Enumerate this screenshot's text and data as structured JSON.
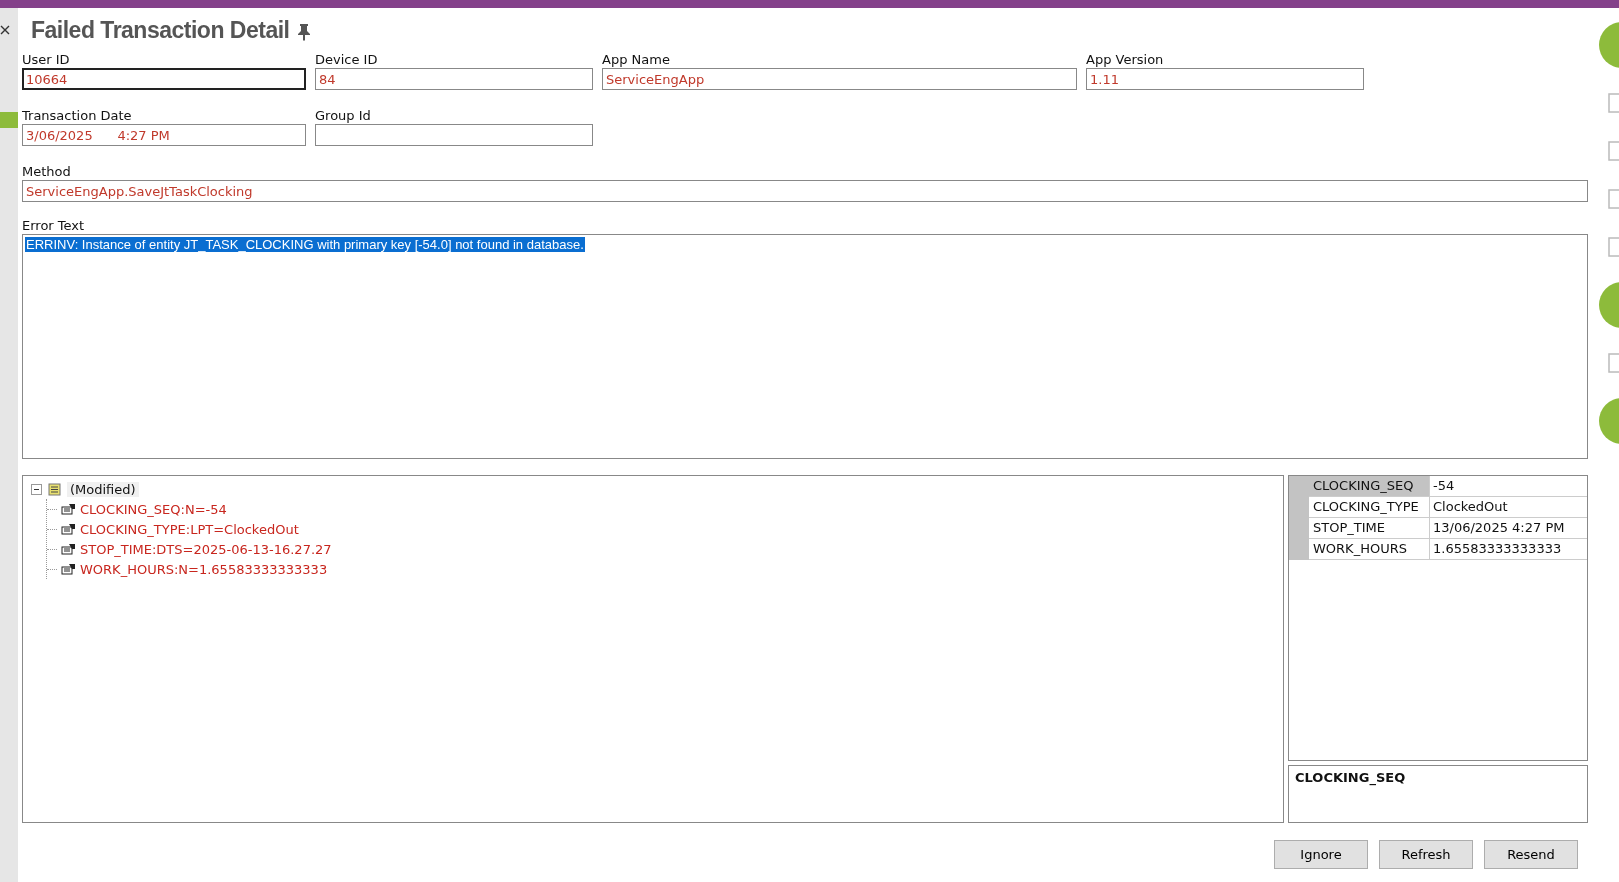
{
  "title": "Failed Transaction Detail",
  "fields": [
    {
      "label": "User ID",
      "value": "10664",
      "focused": true
    },
    {
      "label": "Device ID",
      "value": "84",
      "focused": false
    },
    {
      "label": "App Name",
      "value": "ServiceEngApp",
      "focused": false
    },
    {
      "label": "App Version",
      "value": "1.11",
      "focused": false
    },
    {
      "label": "Transaction Date",
      "value": "3/06/2025      4:27 PM",
      "focused": false
    },
    {
      "label": "Group Id",
      "focused": false
    }
  ],
  "method": {
    "label": "Method",
    "value": "ServiceEngApp.SaveJtTaskClocking"
  },
  "error_text": {
    "label": "Error Text",
    "value": "ERRINV: Instance of entity JT_TASK_CLOCKING with primary key [-54.0] not found in database.",
    "selected": true
  },
  "tree": {
    "label": "(Modified)",
    "expanded": true,
    "children": [
      {
        "label": "CLOCKING_SEQ:N=-54"
      },
      {
        "label": "CLOCKING_TYPE:LPT=ClockedOut"
      },
      {
        "label": "STOP_TIME:DTS=2025-06-13-16.27.27"
      },
      {
        "label": "WORK_HOURS:N=1.65583333333333"
      }
    ]
  },
  "properties": [
    {
      "name": "CLOCKING_SEQ",
      "value": "-54",
      "selected": true
    },
    {
      "name": "CLOCKING_TYPE",
      "value": "ClockedOut",
      "selected": false
    },
    {
      "name": "STOP_TIME",
      "value": "13/06/2025 4:27 PM",
      "selected": false
    },
    {
      "name": "WORK_HOURS",
      "value": "1.65583333333333",
      "selected": false
    }
  ],
  "property_description": "CLOCKING_SEQ",
  "buttons": [
    "Ignore",
    "Refresh",
    "Resend"
  ]
}
